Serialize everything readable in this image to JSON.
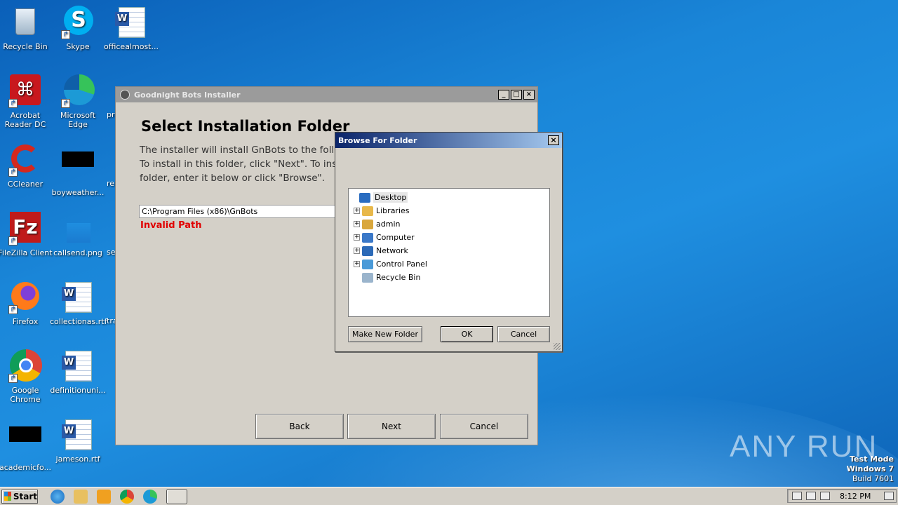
{
  "desktop": {
    "icons": [
      {
        "label": "Recycle Bin"
      },
      {
        "label": "Skype"
      },
      {
        "label": "officealmost..."
      },
      {
        "label": "Acrobat Reader DC"
      },
      {
        "label": "Microsoft Edge"
      },
      {
        "label": "pre"
      },
      {
        "label": "CCleaner"
      },
      {
        "label": "boyweather..."
      },
      {
        "label": "re"
      },
      {
        "label": "FileZilla Client"
      },
      {
        "label": "callsend.png"
      },
      {
        "label": "se"
      },
      {
        "label": "Firefox"
      },
      {
        "label": "collectionas.rtf"
      },
      {
        "label": "tra"
      },
      {
        "label": "Google Chrome"
      },
      {
        "label": "definitionuni..."
      },
      {
        "label": "academicfo..."
      },
      {
        "label": "jameson.rtf"
      }
    ]
  },
  "installer": {
    "title": "Goodnight Bots Installer",
    "heading": "Select Installation Folder",
    "desc_line1": "The installer will install GnBots to the follo",
    "desc_line2": "To install in this folder, click \"Next\". To inst",
    "desc_line3": "folder, enter it below or click \"Browse\".",
    "path_value": "C:\\Program Files (x86)\\GnBots",
    "error": "Invalid Path",
    "back_label": "Back",
    "next_label": "Next",
    "cancel_label": "Cancel",
    "min_glyph": "_",
    "max_glyph": "□",
    "close_glyph": "×"
  },
  "browse": {
    "title": "Browse For Folder",
    "close_glyph": "×",
    "tree": [
      {
        "label": "Desktop",
        "expand": "",
        "icon": "desktop-icon",
        "color": "#2a6cc0"
      },
      {
        "label": "Libraries",
        "expand": "+",
        "icon": "libraries-icon",
        "color": "#e8b84a"
      },
      {
        "label": "admin",
        "expand": "+",
        "icon": "user-folder-icon",
        "color": "#d9a73c"
      },
      {
        "label": "Computer",
        "expand": "+",
        "icon": "computer-icon",
        "color": "#3a78c8"
      },
      {
        "label": "Network",
        "expand": "+",
        "icon": "network-icon",
        "color": "#2c6ab8"
      },
      {
        "label": "Control Panel",
        "expand": "+",
        "icon": "control-panel-icon",
        "color": "#4a9ad8"
      },
      {
        "label": "Recycle Bin",
        "expand": "",
        "icon": "recycle-bin-icon",
        "color": "#9ab4cc"
      }
    ],
    "make_folder_label": "Make New Folder",
    "ok_label": "OK",
    "cancel_label": "Cancel"
  },
  "taskbar": {
    "start_label": "Start",
    "time": "8:12 PM"
  },
  "watermark": {
    "line1": "Test Mode",
    "line2": "Windows 7",
    "line3": "Build 7601",
    "brand": "ANY RUN"
  }
}
